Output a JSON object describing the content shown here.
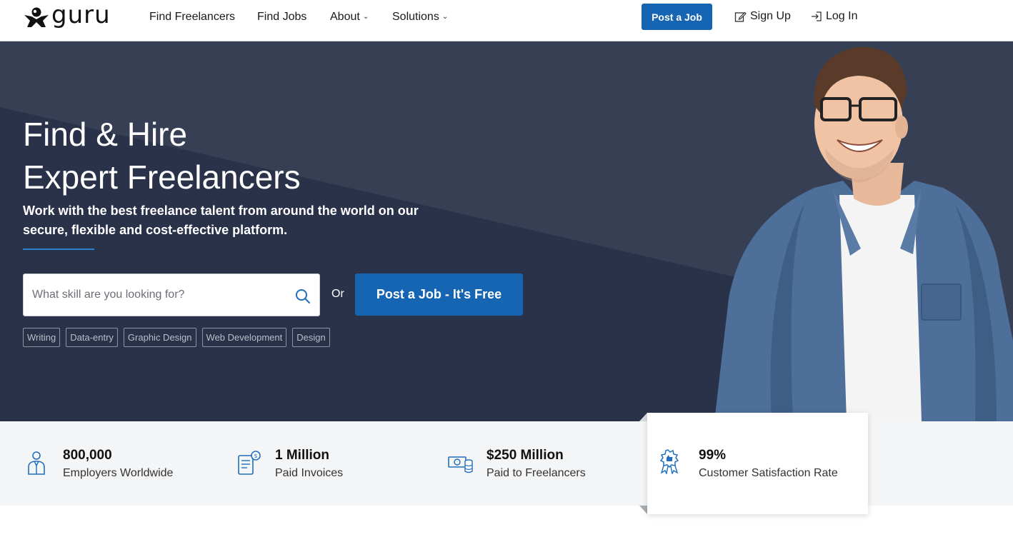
{
  "brand": {
    "name": "guru",
    "icon": "guru-person-logo-icon"
  },
  "nav": {
    "find_freelancers": "Find Freelancers",
    "find_jobs": "Find Jobs",
    "about": "About",
    "solutions": "Solutions",
    "post_job": "Post a Job",
    "sign_up": "Sign Up",
    "log_in": "Log In"
  },
  "hero": {
    "title_line1": "Find & Hire",
    "title_line2": "Expert Freelancers",
    "subtitle": "Work with the best freelance talent from around the world on our secure, flexible and cost-effective platform.",
    "search_placeholder": "What skill are you looking for?",
    "search_value": "",
    "or_text": "Or",
    "cta_label": "Post a Job - It's Free",
    "tags": [
      "Writing",
      "Data-entry",
      "Graphic Design",
      "Web Development",
      "Design"
    ]
  },
  "stats": [
    {
      "value": "800,000",
      "label": "Employers Worldwide",
      "icon": "employer-person-icon"
    },
    {
      "value": "1 Million",
      "label": "Paid Invoices",
      "icon": "invoice-icon"
    },
    {
      "value": "$250 Million",
      "label": "Paid to Freelancers",
      "icon": "money-coins-icon"
    },
    {
      "value": "99%",
      "label": "Customer Satisfaction Rate",
      "icon": "satisfaction-badge-icon"
    }
  ],
  "colors": {
    "primary_blue": "#1565b3",
    "hero_bg": "#2f3a4f",
    "stats_bg": "#f4f5f6",
    "icon_blue": "#1f6fc0"
  }
}
